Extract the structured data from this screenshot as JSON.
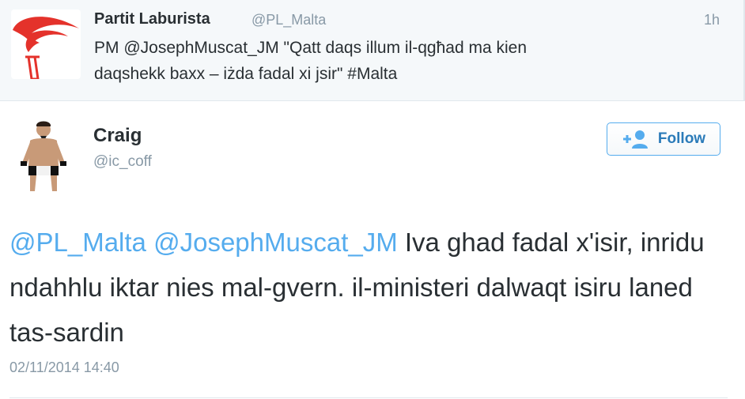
{
  "parent_tweet": {
    "author_name": "Partit Laburista",
    "author_handle": "@PL_Malta",
    "time": "1h",
    "text_line1": "PM @JosephMuscat_JM \"Qatt daqs illum il-qgħad ma kien",
    "text_line2": "daqshekk baxx – iżda fadal xi jsir\" #Malta"
  },
  "tweet": {
    "author_name": "Craig",
    "author_handle": "@ic_coff",
    "follow_label": "Follow",
    "mention1": "@PL_Malta",
    "mention2": "@JosephMuscat_JM",
    "text_after_mentions": " Iva ghad fadal x'isir, inridu ndahhlu iktar nies mal-gvern. il-ministeri dalwaqt isiru laned tas-sardin",
    "timestamp": "02/11/2014 14:40"
  },
  "colors": {
    "link": "#55acee",
    "follow_text": "#2b7bb9",
    "secondary_text": "#8899a6",
    "logo_red": "#e4322b"
  },
  "icons": {
    "party_logo": "torch-logo",
    "avatar": "user-avatar",
    "follow": "add-user-icon"
  }
}
